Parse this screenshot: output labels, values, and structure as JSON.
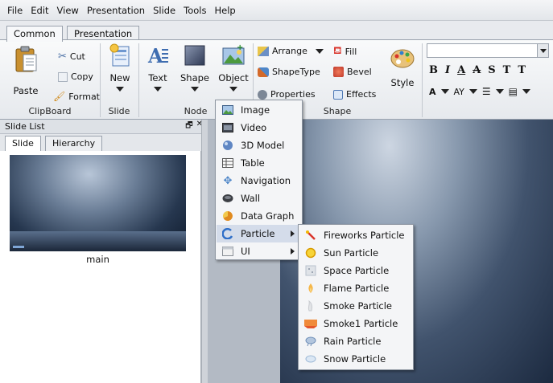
{
  "menubar": {
    "items": [
      "File",
      "Edit",
      "View",
      "Presentation",
      "Slide",
      "Tools",
      "Help"
    ]
  },
  "ribbon_tabs": [
    {
      "label": "Common",
      "active": true
    },
    {
      "label": "Presentation",
      "active": false
    }
  ],
  "ribbon": {
    "clipboard": {
      "paste": "Paste",
      "cut": "Cut",
      "copy": "Copy",
      "format": "Format",
      "group": "ClipBoard"
    },
    "slide": {
      "new": "New",
      "group": "Slide"
    },
    "node": {
      "text": "Text",
      "shape": "Shape",
      "object": "Object",
      "group": "Node"
    },
    "shape": {
      "arrange": "Arrange",
      "shapetype": "ShapeType",
      "properties": "Properties",
      "fill": "Fill",
      "bevel": "Bevel",
      "effects": "Effects",
      "style": "Style",
      "group": "Shape"
    },
    "format": {
      "bold": "B",
      "italic": "I",
      "underline": "A",
      "strike": "A",
      "shadow": "S",
      "superscript": "T",
      "subscript": "T",
      "fontsize": "A",
      "spacing": "AY"
    }
  },
  "slide_panel": {
    "title": "Slide List",
    "float_icon": "float-icon",
    "close_icon": "close-icon",
    "float_glyph": "🗗",
    "close_glyph": "✕",
    "tabs": [
      {
        "label": "Slide",
        "active": true
      },
      {
        "label": "Hierarchy",
        "active": false
      }
    ],
    "thumb_caption": "main"
  },
  "object_menu": [
    {
      "label": "Image",
      "icon": "image-icon",
      "submenu": false
    },
    {
      "label": "Video",
      "icon": "video-icon",
      "submenu": false
    },
    {
      "label": "3D Model",
      "icon": "3d-model-icon",
      "submenu": false
    },
    {
      "label": "Table",
      "icon": "table-icon",
      "submenu": false
    },
    {
      "label": "Navigation",
      "icon": "navigation-icon",
      "submenu": false
    },
    {
      "label": "Wall",
      "icon": "wall-icon",
      "submenu": false
    },
    {
      "label": "Data Graph",
      "icon": "data-graph-icon",
      "submenu": false
    },
    {
      "label": "Particle",
      "icon": "particle-icon",
      "submenu": true,
      "highlighted": true
    },
    {
      "label": "UI",
      "icon": "ui-icon",
      "submenu": true
    }
  ],
  "particle_menu": [
    {
      "label": "Fireworks Particle",
      "icon": "fireworks-icon",
      "color": "#d9342b"
    },
    {
      "label": "Sun Particle",
      "icon": "sun-icon",
      "color": "#f2b705"
    },
    {
      "label": "Space Particle",
      "icon": "space-icon",
      "color": "#b9c1cc"
    },
    {
      "label": "Flame Particle",
      "icon": "flame-icon",
      "color": "#f0a030"
    },
    {
      "label": "Smoke Particle",
      "icon": "smoke-icon",
      "color": "#c9ccd1"
    },
    {
      "label": "Smoke1 Particle",
      "icon": "smoke1-icon",
      "color": "#e5562a"
    },
    {
      "label": "Rain Particle",
      "icon": "rain-icon",
      "color": "#6f8fb8"
    },
    {
      "label": "Snow Particle",
      "icon": "snow-icon",
      "color": "#9db8d6"
    }
  ]
}
